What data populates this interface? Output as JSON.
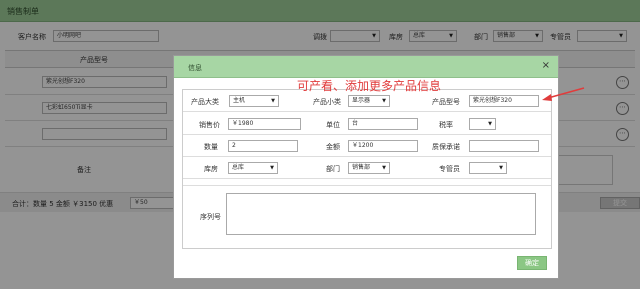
{
  "window": {
    "title": "销售制单"
  },
  "filters": {
    "customer_label": "客户名称",
    "customer_value": "小明网吧",
    "adjust_label": "调拨",
    "warehouse_label": "库房",
    "warehouse_value": "总库",
    "dept_label": "部门",
    "dept_value": "销售部",
    "manager_label": "专管员"
  },
  "table": {
    "header_model": "产品型号",
    "rows": [
      {
        "model": "紫光创想F320"
      },
      {
        "model": "七彩虹650Ti显卡"
      },
      {
        "model": ""
      }
    ],
    "more_icon": "⋯",
    "remark_label": "备注"
  },
  "footer": {
    "summary": "合计：数量 5  金额 ￥3150  优惠",
    "discount_value": "￥50",
    "submit_label": "提交"
  },
  "modal": {
    "title": "信息",
    "close": "×",
    "category_label": "产品大类",
    "category_value": "主机",
    "subcategory_label": "产品小类",
    "subcategory_value": "显示器",
    "model_label": "产品型号",
    "model_value": "紫光创想F320",
    "price_label": "销售价",
    "price_value": "￥1980",
    "unit_label": "单位",
    "unit_value": "台",
    "tax_label": "税率",
    "qty_label": "数量",
    "qty_value": "2",
    "amount_label": "金额",
    "amount_value": "￥1200",
    "warranty_label": "质保承诺",
    "warehouse_label": "库房",
    "warehouse_value": "总库",
    "dept_label": "部门",
    "dept_value": "销售部",
    "manager_label": "专管员",
    "serial_label": "序列号",
    "ok_label": "确定"
  },
  "annotation": {
    "text": "可产看、添加更多产品信息",
    "color": "#e03c3c"
  },
  "icons": {
    "dropdown": "▼",
    "more": "more-icon",
    "close": "close-icon"
  }
}
